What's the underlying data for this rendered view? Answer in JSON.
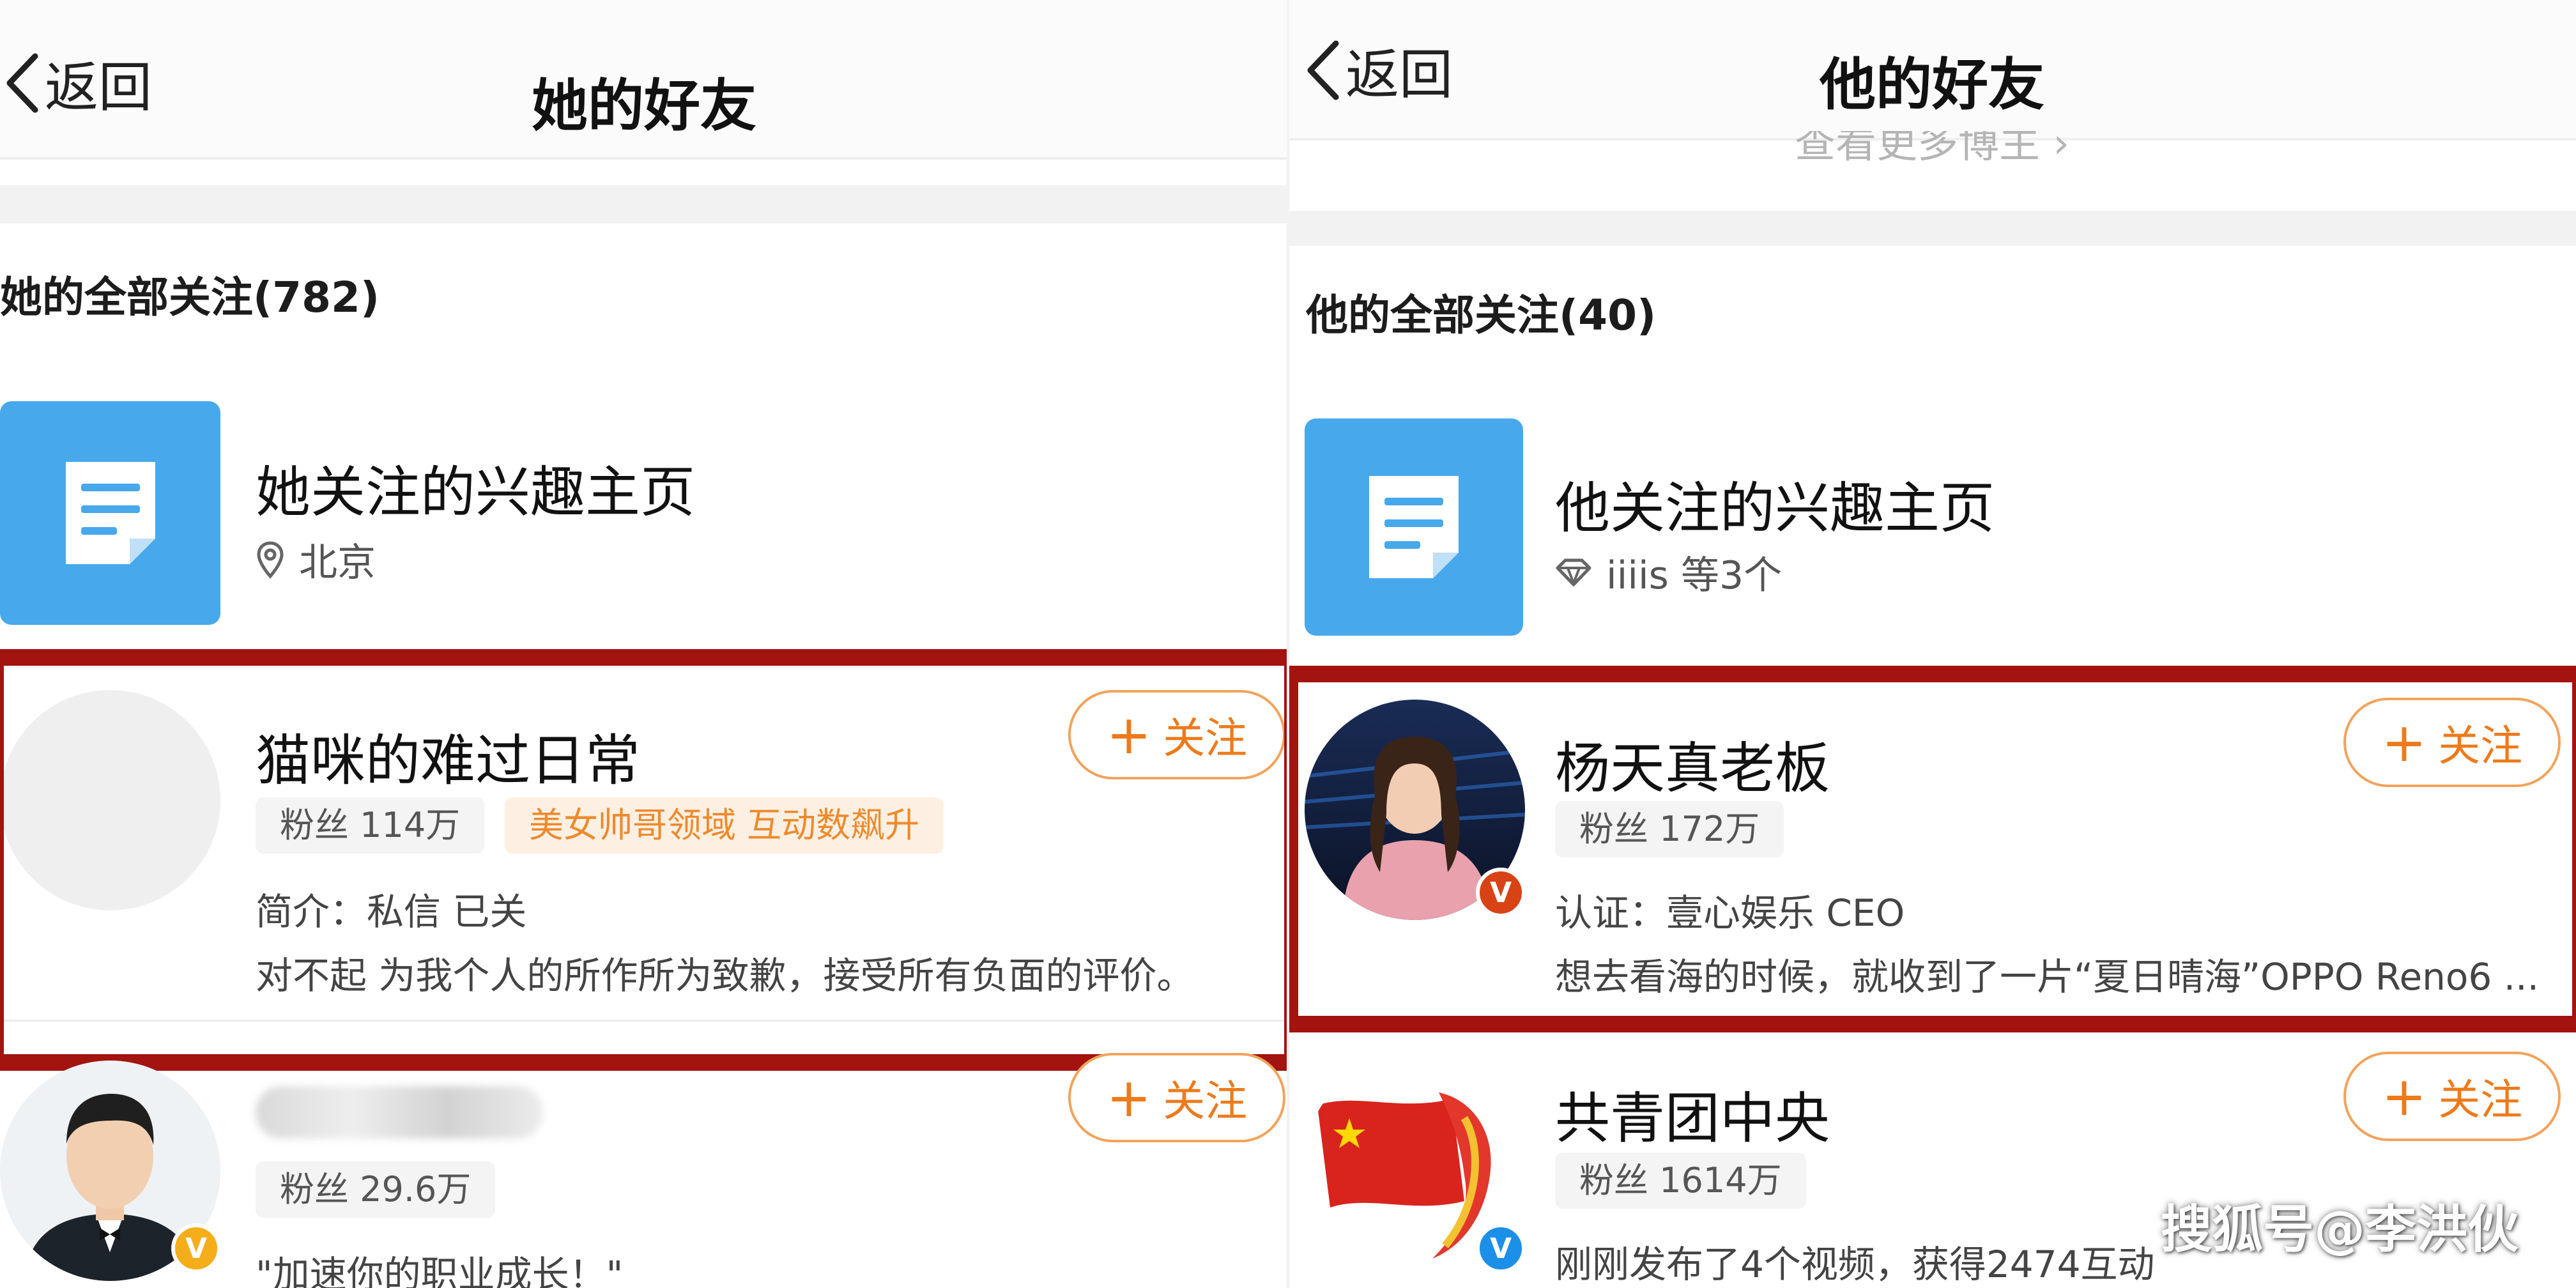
{
  "left": {
    "nav": {
      "back_label": "返回",
      "title": "她的好友"
    },
    "section_title": "她的全部关注(782)",
    "interest": {
      "title": "她关注的兴趣主页",
      "meta": "北京",
      "meta_icon": "location-pin-icon"
    },
    "users": [
      {
        "name": "猫咪的难过日常",
        "fans": "粉丝 114万",
        "tag": "美女帅哥领域 互动数飙升",
        "intro1": "简介：私信 已关",
        "intro2": "对不起 为我个人的所作所为致歉，接受所有负面的评价。",
        "follow": "关注",
        "highlighted": true
      },
      {
        "name": "",
        "fans": "粉丝 29.6万",
        "intro1": "\"加速你的职业成长！\"",
        "follow": "关注",
        "badge": "V"
      }
    ]
  },
  "right": {
    "nav": {
      "back_label": "返回",
      "title": "他的好友"
    },
    "top_link": "查看更多博主 ›",
    "section_title": "他的全部关注(40)",
    "interest": {
      "title": "他关注的兴趣主页",
      "meta": "iiiis 等3个",
      "meta_icon": "diamond-icon"
    },
    "users": [
      {
        "name": "杨天真老板",
        "fans": "粉丝 172万",
        "intro1": "认证：壹心娱乐 CEO",
        "intro2": "想去看海的时候，就收到了一片“夏日晴海”OPPO Reno6 ...",
        "follow": "关注",
        "badge": "V",
        "highlighted": true
      },
      {
        "name": "共青团中央",
        "fans": "粉丝 1614万",
        "intro1": "刚刚发布了4个视频，获得2474互动",
        "follow": "关注",
        "badge": "V"
      }
    ]
  },
  "watermark": "搜狐号@李洪伙",
  "colors": {
    "accent_orange": "#ee7a1b",
    "highlight_red": "#a3130f",
    "interest_blue": "#47a8ec"
  }
}
